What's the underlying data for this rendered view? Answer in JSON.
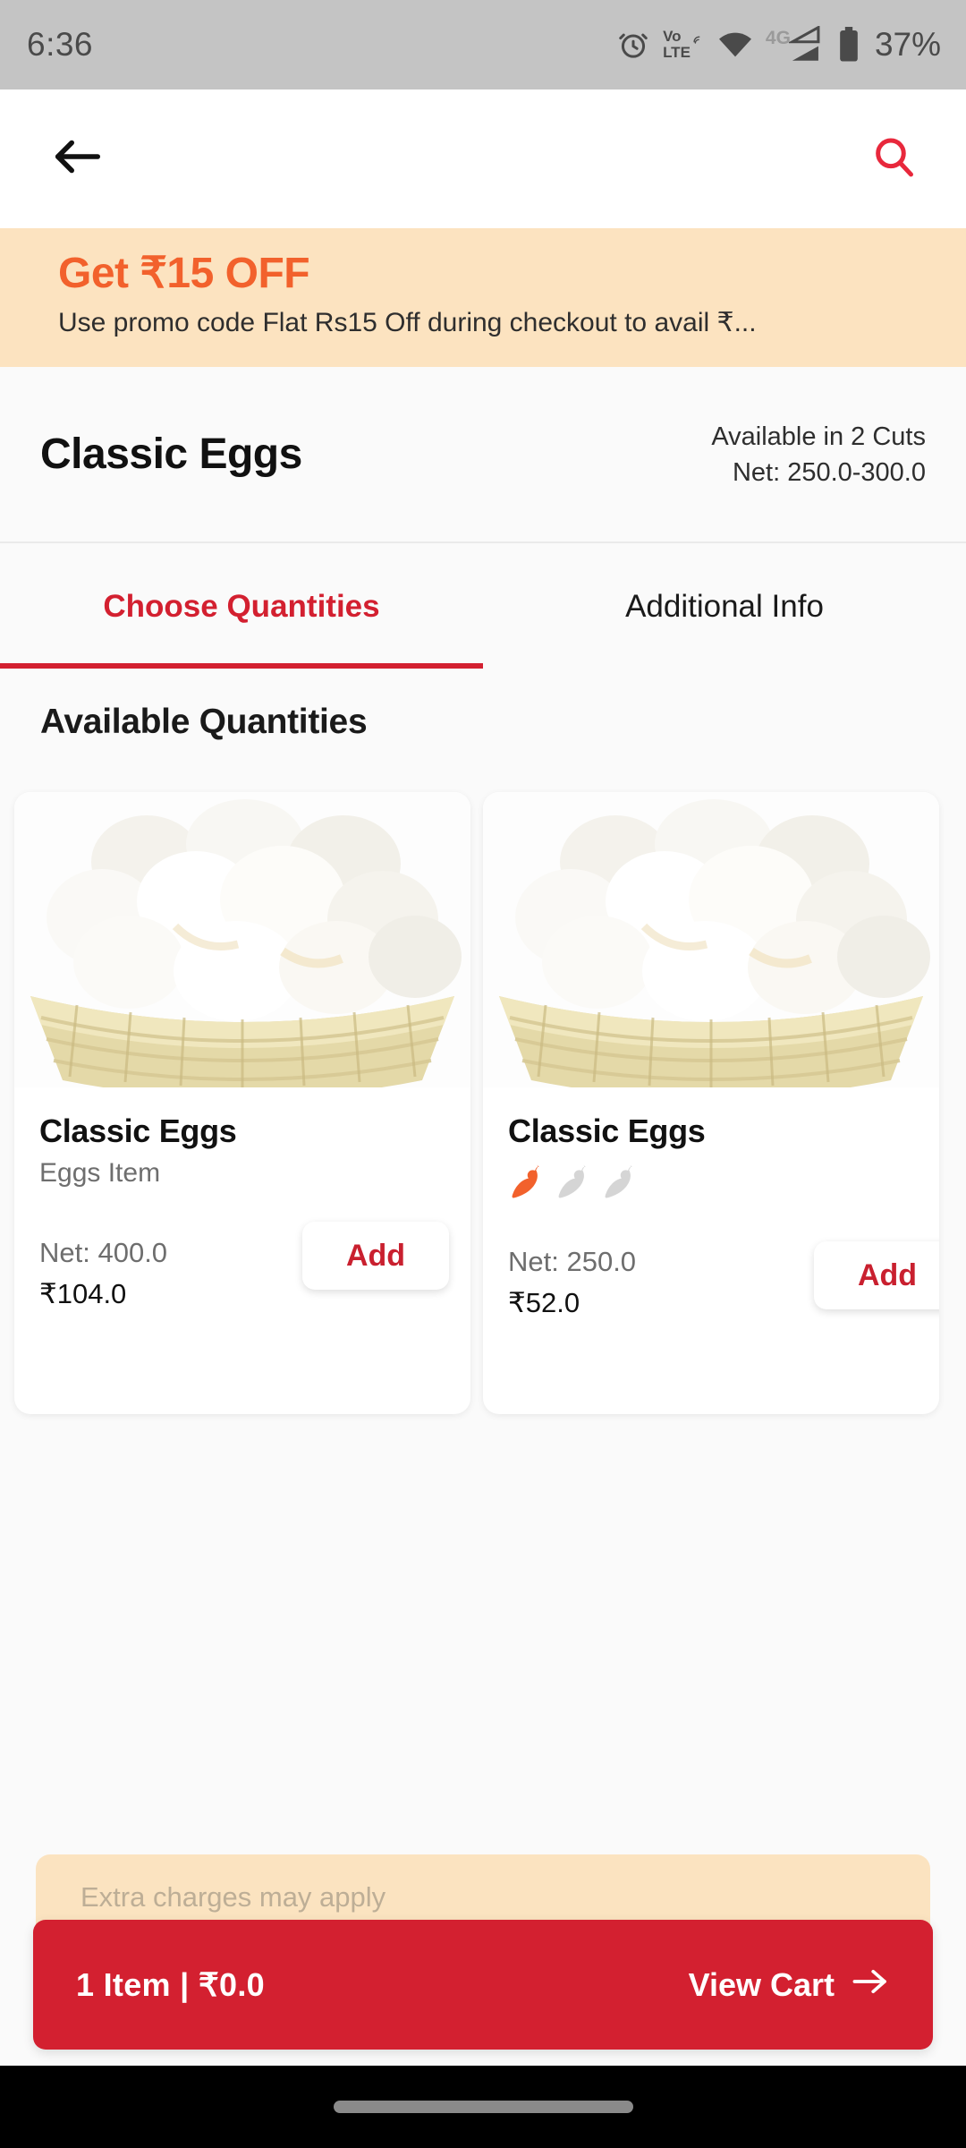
{
  "status_bar": {
    "time": "6:36",
    "battery_percent": "37%",
    "volte_line1": "Vo",
    "volte_line2": "LTE",
    "network_type": "4G",
    "icons": [
      "alarm-clock-icon",
      "volte-icon",
      "wifi-icon",
      "signal-icon",
      "battery-icon"
    ]
  },
  "app_bar": {
    "back_icon": "back-arrow-icon",
    "search_icon": "search-icon"
  },
  "promo": {
    "title": "Get ₹15 OFF",
    "subtitle": "Use promo code Flat Rs15 Off  during checkout to avail ₹..."
  },
  "product": {
    "name": "Classic Eggs",
    "cuts": "Available in 2 Cuts",
    "net": "Net: 250.0-300.0"
  },
  "tabs": [
    {
      "label": "Choose Quantities",
      "active": true
    },
    {
      "label": "Additional Info",
      "active": false
    }
  ],
  "section": {
    "heading": "Available Quantities"
  },
  "cards": [
    {
      "title": "Classic Eggs",
      "subtitle": "Eggs Item",
      "net": "Net: 400.0",
      "price": "₹104.0",
      "add_label": "Add",
      "spice_level": 0,
      "spice_total": 0,
      "image_alt": "eggs-basket-image"
    },
    {
      "title": "Classic Eggs",
      "subtitle": "",
      "net": "Net: 250.0",
      "price": "₹52.0",
      "add_label": "Add",
      "spice_level": 1,
      "spice_total": 3,
      "image_alt": "eggs-basket-image"
    }
  ],
  "bottom_bar": {
    "extra_charges": "Extra charges may apply",
    "cart_summary": "1 Item | ₹0.0",
    "cart_action": "View Cart",
    "arrow_icon": "arrow-right-icon"
  },
  "colors": {
    "accent_red": "#D32030",
    "promo_orange": "#F2612C",
    "promo_bg": "#FCE3C0",
    "spice_active": "#F2612C",
    "spice_inactive": "#D5D5D5",
    "status_bar_bg": "#C4C4C4",
    "page_bg": "#FAFAFA"
  }
}
